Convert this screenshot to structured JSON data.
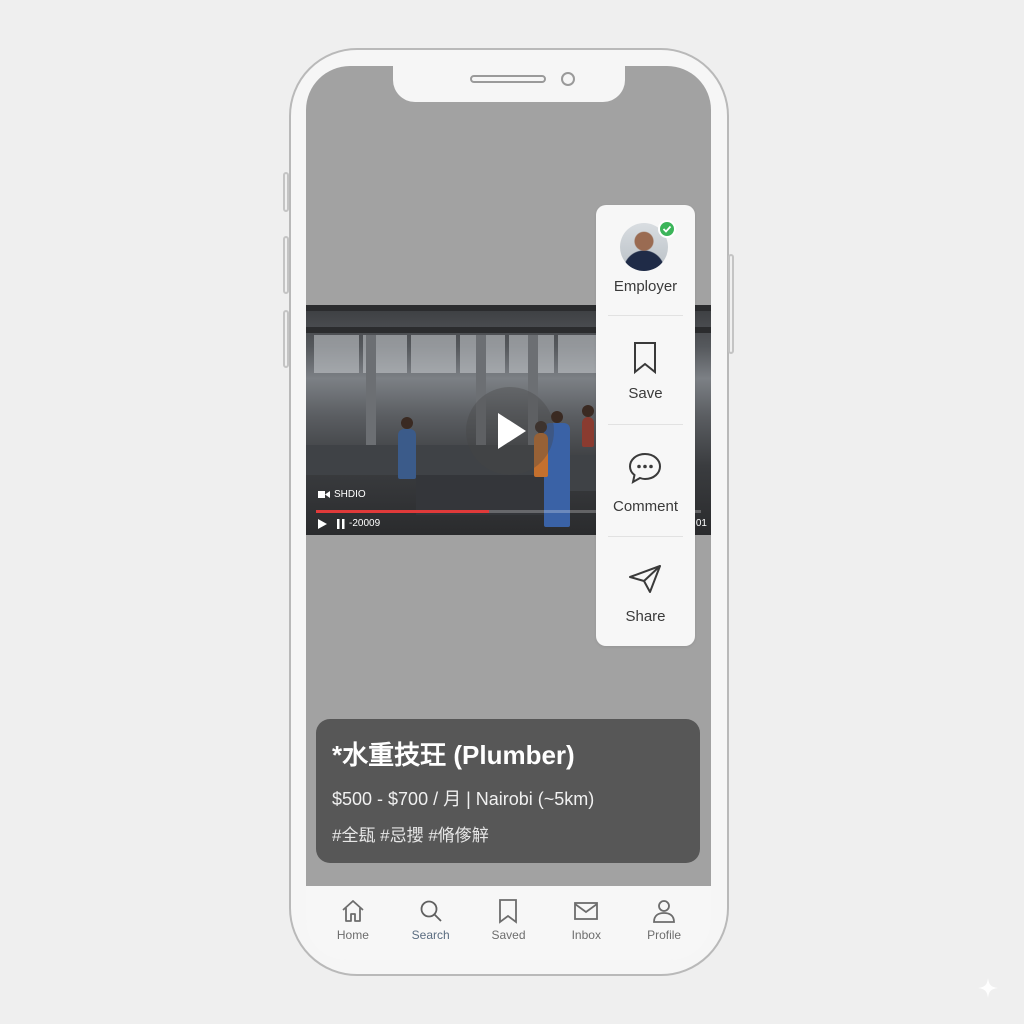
{
  "video": {
    "label": "SHDIO",
    "time": "-20009",
    "time_right": "01",
    "progress": 0.45
  },
  "actions": {
    "employer": "Employer",
    "save": "Save",
    "comment": "Comment",
    "share": "Share"
  },
  "job": {
    "title": "*水重技玨 (Plumber)",
    "meta": "$500 - $700 / 月 | Nairobi (~5km)",
    "tags": "#全瓺 #忌攖 #脩偧觪"
  },
  "nav": {
    "items": [
      {
        "label": "Home",
        "icon": "home-icon"
      },
      {
        "label": "Search",
        "icon": "search-icon"
      },
      {
        "label": "Saved",
        "icon": "bookmark-icon"
      },
      {
        "label": "Inbox",
        "icon": "mail-icon"
      },
      {
        "label": "Profile",
        "icon": "person-icon"
      }
    ],
    "active": "Search"
  },
  "colors": {
    "screen_bg": "#a2a2a2",
    "card_bg": "#575757",
    "progress": "#e03a3a",
    "verified": "#3cb55a",
    "active_nav": "#5a6c80"
  }
}
